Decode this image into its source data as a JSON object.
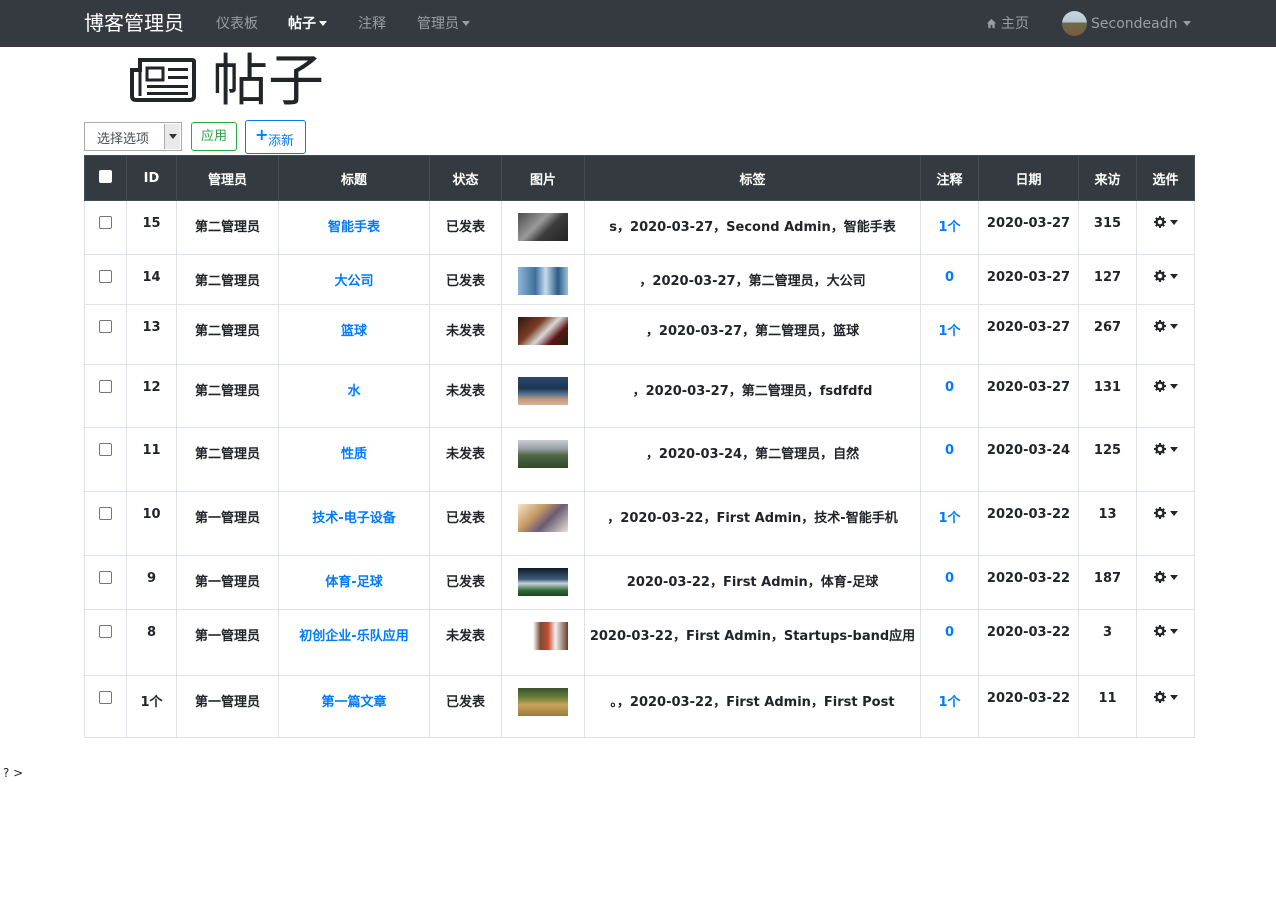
{
  "nav": {
    "brand": "博客管理员",
    "links": [
      {
        "label": "仪表板",
        "active": false,
        "dropdown": false
      },
      {
        "label": "帖子",
        "active": true,
        "dropdown": true
      },
      {
        "label": "注释",
        "active": false,
        "dropdown": false
      },
      {
        "label": "管理员",
        "active": false,
        "dropdown": true
      }
    ],
    "home_label": "主页",
    "user_name": "Secondeadn"
  },
  "page": {
    "title": "帖子",
    "title_icon": "newspaper-icon"
  },
  "toolbar": {
    "bulk_select_value": "选择选项",
    "apply_label": "应用",
    "add_new_label": "添新"
  },
  "table": {
    "columns": [
      "ID",
      "管理员",
      "标题",
      "状态",
      "图片",
      "标签",
      "注释",
      "日期",
      "来访",
      "选件"
    ],
    "rows": [
      {
        "id": "15",
        "author": "第二管理员",
        "title": "智能手表",
        "status": "已发表",
        "image": "smartwatch-photo",
        "tags": "s，2020-03-27，Second Admin，智能手表",
        "comments": "1个",
        "date": "2020-03-27",
        "views": "315"
      },
      {
        "id": "14",
        "author": "第二管理员",
        "title": "大公司",
        "status": "已发表",
        "image": "skyscraper-photo",
        "tags": "，2020-03-27，第二管理员，大公司",
        "comments": "0",
        "date": "2020-03-27",
        "views": "127"
      },
      {
        "id": "13",
        "author": "第二管理员",
        "title": "篮球",
        "status": "未发表",
        "image": "basketball-player-photo",
        "tags": "，2020-03-27，第二管理员，篮球",
        "comments": "1个",
        "date": "2020-03-27",
        "views": "267"
      },
      {
        "id": "12",
        "author": "第二管理员",
        "title": "水",
        "status": "未发表",
        "image": "water-photo",
        "tags": "，2020-03-27，第二管理员，fsdfdfd",
        "comments": "0",
        "date": "2020-03-27",
        "views": "131"
      },
      {
        "id": "11",
        "author": "第二管理员",
        "title": "性质",
        "status": "未发表",
        "image": "nature-landscape-photo",
        "tags": "，2020-03-24，第二管理员，自然",
        "comments": "0",
        "date": "2020-03-24",
        "views": "125"
      },
      {
        "id": "10",
        "author": "第一管理员",
        "title": "技术-电子设备",
        "status": "已发表",
        "image": "devices-photo",
        "tags": "，2020-03-22，First Admin，技术-智能手机",
        "comments": "1个",
        "date": "2020-03-22",
        "views": "13"
      },
      {
        "id": "9",
        "author": "第一管理员",
        "title": "体育-足球",
        "status": "已发表",
        "image": "football-photo",
        "tags": "2020-03-22，First Admin，体育-足球",
        "comments": "0",
        "date": "2020-03-22",
        "views": "187"
      },
      {
        "id": "8",
        "author": "第一管理员",
        "title": "初创企业-乐队应用",
        "status": "未发表",
        "image": "startup-photo",
        "tags": "2020-03-22，First Admin，Startups-band应用",
        "comments": "0",
        "date": "2020-03-22",
        "views": "3"
      },
      {
        "id": "1个",
        "author": "第一管理员",
        "title": "第一篇文章",
        "status": "已发表",
        "image": "wheat-field-photo",
        "tags": "。，2020-03-22，First Admin，First Post",
        "comments": "1个",
        "date": "2020-03-22",
        "views": "11"
      }
    ],
    "row_action_icon": "gear-icon"
  },
  "footer_text": "? >",
  "colors": {
    "navbar_bg": "#343a40",
    "link": "#007bff",
    "success": "#28a745"
  }
}
